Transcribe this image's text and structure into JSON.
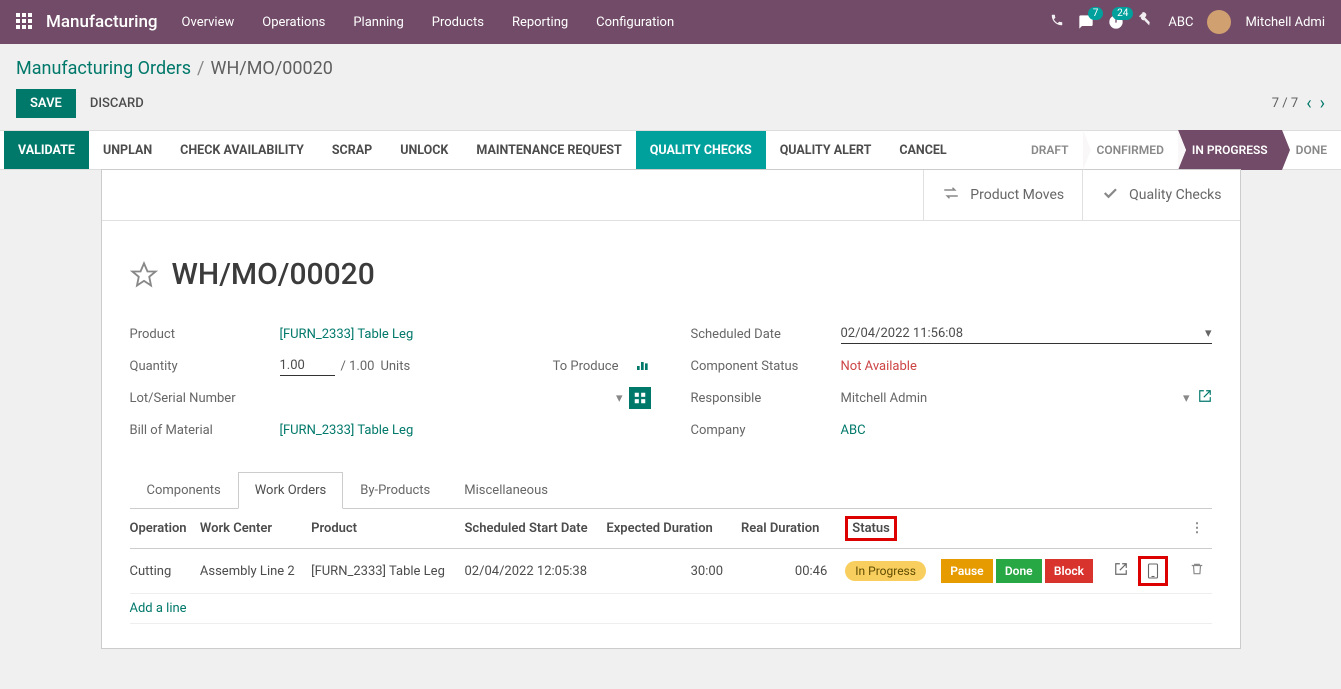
{
  "topbar": {
    "brand": "Manufacturing",
    "nav": [
      "Overview",
      "Operations",
      "Planning",
      "Products",
      "Reporting",
      "Configuration"
    ],
    "chat_badge": "7",
    "activity_badge": "24",
    "company": "ABC",
    "user": "Mitchell Admi"
  },
  "breadcrumbs": {
    "parent": "Manufacturing Orders",
    "current": "WH/MO/00020"
  },
  "actions": {
    "save": "SAVE",
    "discard": "DISCARD",
    "pager": "7 / 7"
  },
  "toolbar": {
    "validate": "VALIDATE",
    "unplan": "UNPLAN",
    "check_availability": "CHECK AVAILABILITY",
    "scrap": "SCRAP",
    "unlock": "UNLOCK",
    "maintenance_request": "MAINTENANCE REQUEST",
    "quality_checks": "QUALITY CHECKS",
    "quality_alert": "QUALITY ALERT",
    "cancel": "CANCEL"
  },
  "stages": {
    "draft": "DRAFT",
    "confirmed": "CONFIRMED",
    "in_progress": "IN PROGRESS",
    "done": "DONE"
  },
  "sheet_buttons": {
    "product_moves": "Product Moves",
    "quality_checks": "Quality Checks"
  },
  "record": {
    "title": "WH/MO/00020",
    "product_label": "Product",
    "product": "[FURN_2333] Table Leg",
    "quantity_label": "Quantity",
    "quantity": "1.00",
    "quantity_total": "/ 1.00",
    "quantity_unit": "Units",
    "to_produce": "To Produce",
    "lot_label": "Lot/Serial Number",
    "bom_label": "Bill of Material",
    "bom": "[FURN_2333] Table Leg",
    "scheduled_label": "Scheduled Date",
    "scheduled": "02/04/2022 11:56:08",
    "component_status_label": "Component Status",
    "component_status": "Not Available",
    "responsible_label": "Responsible",
    "responsible": "Mitchell Admin",
    "company_label": "Company",
    "company": "ABC"
  },
  "tabs": {
    "components": "Components",
    "work_orders": "Work Orders",
    "by_products": "By-Products",
    "miscellaneous": "Miscellaneous"
  },
  "wo_headers": {
    "operation": "Operation",
    "work_center": "Work Center",
    "product": "Product",
    "scheduled_start": "Scheduled Start Date",
    "expected_duration": "Expected Duration",
    "real_duration": "Real Duration",
    "status": "Status"
  },
  "wo_row": {
    "operation": "Cutting",
    "work_center": "Assembly Line 2",
    "product": "[FURN_2333] Table Leg",
    "scheduled_start": "02/04/2022 12:05:38",
    "expected_duration": "30:00",
    "real_duration": "00:46",
    "status": "In Progress",
    "pause": "Pause",
    "done": "Done",
    "block": "Block"
  },
  "add_line": "Add a line"
}
